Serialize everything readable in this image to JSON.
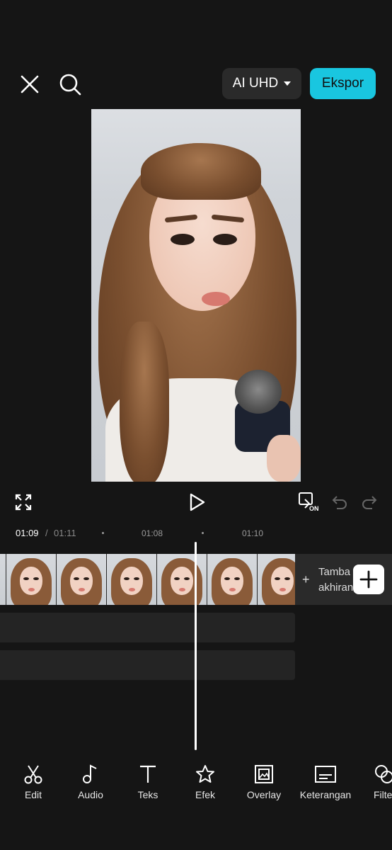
{
  "header": {
    "quality_label": "AI UHD",
    "export_label": "Ekspor",
    "accent_color": "#19c6e0"
  },
  "icons": [
    "close-icon",
    "search-icon",
    "fullscreen-icon",
    "play-icon",
    "original-sound-on-icon",
    "undo-icon",
    "redo-icon"
  ],
  "controls": {
    "on_badge": "ON"
  },
  "timeline": {
    "current_time": "01:09",
    "separator": "/",
    "total_time": "01:11",
    "ticks": [
      "01:08",
      "01:10"
    ],
    "ending_plus": "+",
    "ending_label_line1": "Tamba",
    "ending_label_line2": "akhiran"
  },
  "toolbar": [
    {
      "label": "Edit",
      "icon": "scissors-icon"
    },
    {
      "label": "Audio",
      "icon": "music-note-icon"
    },
    {
      "label": "Teks",
      "icon": "text-icon"
    },
    {
      "label": "Efek",
      "icon": "effects-star-icon"
    },
    {
      "label": "Overlay",
      "icon": "overlay-icon"
    },
    {
      "label": "Keterangan",
      "icon": "captions-icon"
    },
    {
      "label": "Filte",
      "icon": "filter-icon"
    }
  ]
}
